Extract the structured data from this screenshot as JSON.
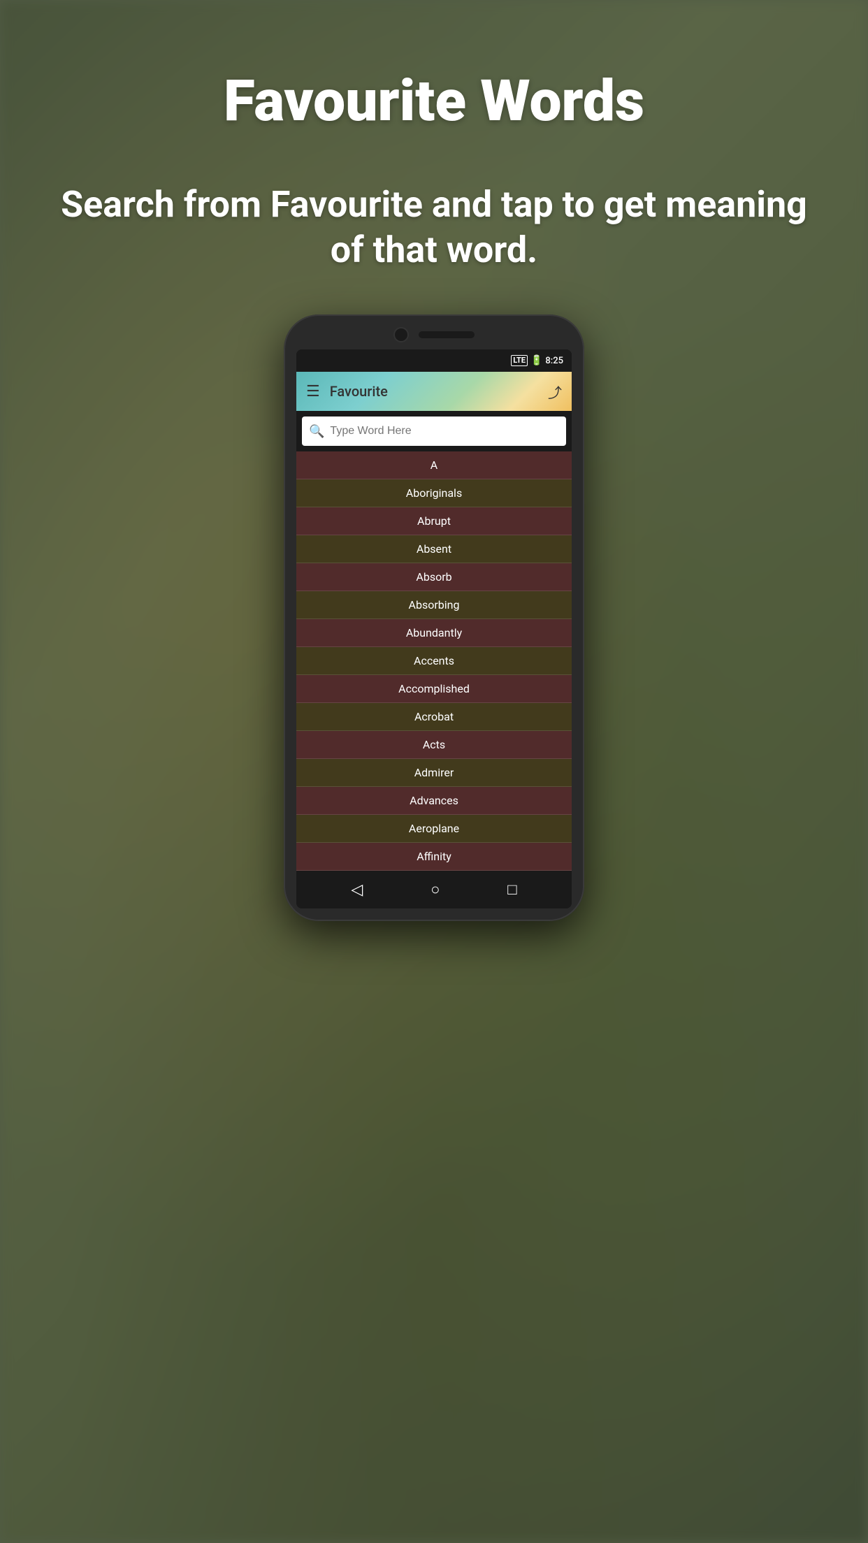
{
  "page": {
    "title": "Favourite Words",
    "subtitle": "Search from Favourite and tap to get meaning of that word.",
    "background_colors": {
      "primary": "#6b7a5e",
      "overlay": "rgba(50,55,40,0.45)"
    }
  },
  "status_bar": {
    "time": "8:25",
    "lte": "LTE",
    "battery_icon": "🔋"
  },
  "app_header": {
    "menu_icon": "☰",
    "title": "Favourite",
    "share_icon": "⤴"
  },
  "search": {
    "placeholder": "Type Word Here",
    "icon": "🔍"
  },
  "word_list": [
    {
      "word": "A"
    },
    {
      "word": "Aboriginals"
    },
    {
      "word": "Abrupt"
    },
    {
      "word": "Absent"
    },
    {
      "word": "Absorb"
    },
    {
      "word": "Absorbing"
    },
    {
      "word": "Abundantly"
    },
    {
      "word": "Accents"
    },
    {
      "word": "Accomplished"
    },
    {
      "word": "Acrobat"
    },
    {
      "word": "Acts"
    },
    {
      "word": "Admirer"
    },
    {
      "word": "Advances"
    },
    {
      "word": "Aeroplane"
    },
    {
      "word": "Affinity"
    }
  ],
  "nav_bar": {
    "back": "◁",
    "home": "○",
    "recent": "□"
  }
}
